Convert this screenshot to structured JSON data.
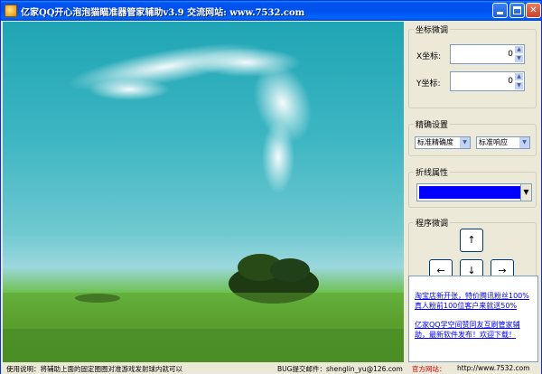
{
  "window": {
    "title": "亿家QQ开心泡泡猫瞄准器管家辅助v3.9  交流网站: www.7532.com"
  },
  "coord_group": {
    "legend": "坐标微调",
    "x_label": "X坐标:",
    "x_value": "0",
    "y_label": "Y坐标:",
    "y_value": "0"
  },
  "precision_group": {
    "legend": "精确设置",
    "precision_select": "标准精确度",
    "response_select": "标准响应"
  },
  "line_group": {
    "legend": "折线属性",
    "color": "#0000ff"
  },
  "program_group": {
    "legend": "程序微调",
    "up": "↑",
    "left": "←",
    "down": "↓",
    "right": "→"
  },
  "news": {
    "items": [
      "淘宝店新开张，特价腾讯粉丝100%真人粉前100位客户来就送50%",
      "亿家QQ学空间赞同友互刷管家辅助，最新软件发布！欢迎下载！"
    ]
  },
  "status": {
    "usage": "使用说明：将辅助上面的固定圈圈对准游戏发射球内就可以",
    "bug": "BUG提交邮件：shenglin_yu@126.com",
    "site_label": "官方网站：",
    "site": "http://www.7532.com"
  }
}
